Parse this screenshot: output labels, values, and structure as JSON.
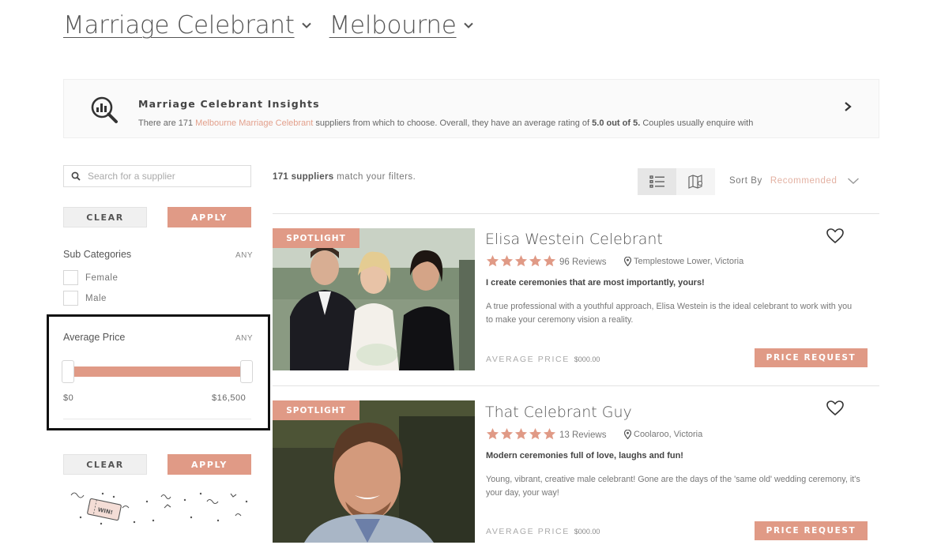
{
  "breadcrumb": {
    "category": "Marriage Celebrant",
    "location": "Melbourne"
  },
  "insights": {
    "title": "Marriage Celebrant Insights",
    "desc_before": "There are 171 ",
    "desc_link": "Melbourne Marriage Celebrant",
    "desc_middle": " suppliers from which to choose. Overall, they have an average rating of ",
    "desc_rating": "5.0 out of 5.",
    "desc_after": " Couples usually enquire with"
  },
  "sidebar": {
    "search_placeholder": "Search for a supplier",
    "clear_label": "CLEAR",
    "apply_label": "APPLY",
    "subcategories": {
      "label": "Sub Categories",
      "any": "ANY",
      "options": [
        "Female",
        "Male"
      ]
    },
    "average_price": {
      "label": "Average Price",
      "any": "ANY",
      "min_label": "$0",
      "max_label": "$16,500",
      "range_selected": [
        0,
        1
      ]
    },
    "promo_text": "WIN!"
  },
  "results": {
    "count_number": "171 suppliers",
    "count_text": " match your filters.",
    "sort_label": "Sort By",
    "sort_value": "Recommended",
    "view_modes": [
      "list",
      "map"
    ],
    "active_view": "list",
    "accent_color": "#e09a86",
    "star_color": "#e09a86",
    "cards": [
      {
        "badge": "SPOTLIGHT",
        "name": "Elisa Westein Celebrant",
        "rating": 5,
        "reviews": "96 Reviews",
        "location": "Templestowe Lower, Victoria",
        "tagline": "I create ceremonies that are most importantly, yours!",
        "description": "A true professional with a youthful approach, Elisa Westein is the ideal celebrant to work with you to make your ceremony vision a reality.",
        "avg_label": "AVERAGE PRICE",
        "avg_amount": "$000.00",
        "cta": "PRICE REQUEST"
      },
      {
        "badge": "SPOTLIGHT",
        "name": "That Celebrant Guy",
        "rating": 5,
        "reviews": "13 Reviews",
        "location": "Coolaroo, Victoria",
        "tagline": "Modern ceremonies full of love, laughs and fun!",
        "description": "Young, vibrant, creative male celebrant! Gone are the days of the 'same old' wedding ceremony, it's your day, your way!",
        "avg_label": "AVERAGE PRICE",
        "avg_amount": "$000.00",
        "cta": "PRICE REQUEST"
      }
    ]
  }
}
